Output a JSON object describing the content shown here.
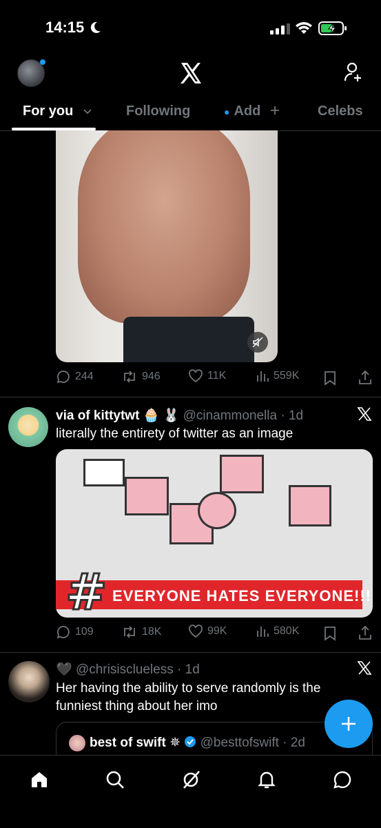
{
  "status_bar": {
    "time": "14:15"
  },
  "header": {
    "tabs": [
      {
        "label": "For you"
      },
      {
        "label": "Following"
      },
      {
        "label": "Add"
      },
      {
        "label": "Celebs"
      }
    ]
  },
  "post1": {
    "stats": {
      "replies": "244",
      "reposts": "946",
      "likes": "11K",
      "views": "559K"
    }
  },
  "post2": {
    "name": "via of kittytwt",
    "emojis": "🧁 🐰",
    "handle": "@cinammonella",
    "time": "1d",
    "text": "literally the entirety of twitter as an image",
    "media_caption": "EVERYONE HATES EVERYONE!!!!",
    "media_hash": "#",
    "stats": {
      "replies": "109",
      "reposts": "18K",
      "likes": "99K",
      "views": "580K"
    }
  },
  "post3": {
    "name_emoji": "🖤",
    "handle": "@chrisisclueless",
    "time": "1d",
    "text": "Her having the ability to serve randomly is the funniest thing about her imo",
    "quote": {
      "name": "best of swift",
      "badge": "✵",
      "handle": "@besttofswift",
      "time": "2d"
    }
  },
  "colors": {
    "accent": "#1d9bf0",
    "muted": "#71767b",
    "divider": "#2f3336",
    "banner_red": "#e0262b"
  }
}
